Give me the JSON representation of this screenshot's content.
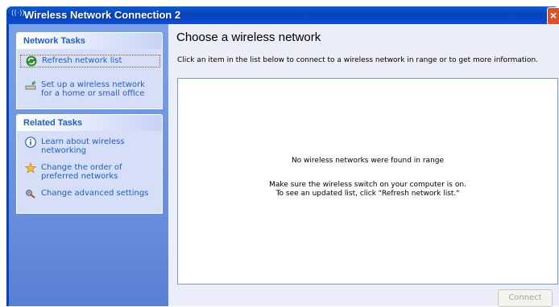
{
  "window": {
    "title": "Wireless Network Connection 2",
    "title_icon_glyph": "((·))",
    "close_glyph": "×"
  },
  "sidebar": {
    "network_tasks": {
      "heading": "Network Tasks",
      "items": [
        {
          "label": "Refresh network list",
          "icon": "refresh-icon"
        },
        {
          "label": "Set up a wireless network for a home or small office",
          "icon": "setup-network-icon"
        }
      ]
    },
    "related_tasks": {
      "heading": "Related Tasks",
      "items": [
        {
          "label": "Learn about wireless networking",
          "icon": "info-icon"
        },
        {
          "label": "Change the order of preferred networks",
          "icon": "star-icon"
        },
        {
          "label": "Change advanced settings",
          "icon": "settings-icon"
        }
      ]
    }
  },
  "main": {
    "title": "Choose a wireless network",
    "description": "Click an item in the list below to connect to a wireless network in range or to get more information.",
    "empty_message": "No wireless networks were found in range",
    "hint_line1": "Make sure the wireless switch on your computer is on.",
    "hint_line2": "To see an updated list, click \"Refresh network list.\"",
    "connect_label": "Connect"
  },
  "colors": {
    "titlebar": "#0842b8",
    "sidebar_bg": "#6b90dc",
    "link": "#215dc6",
    "main_bg": "#ebeef8"
  }
}
